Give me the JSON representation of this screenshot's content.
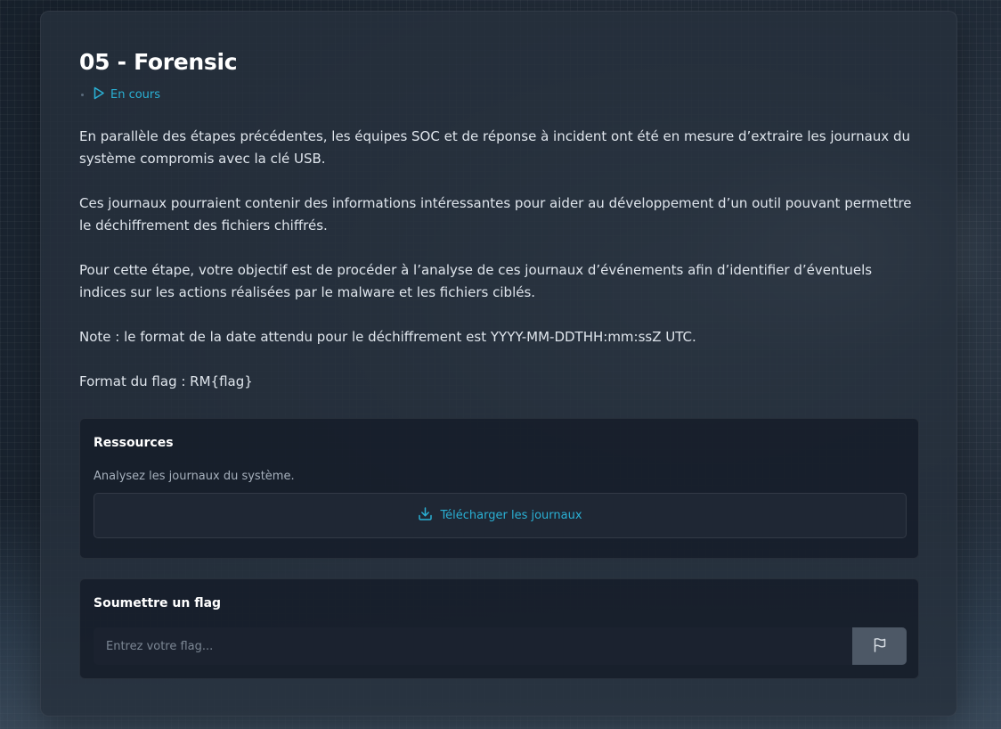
{
  "challenge": {
    "title": "05 - Forensic",
    "status": {
      "label": "En cours",
      "icon": "play-icon",
      "color": "#2ab0d4"
    },
    "description": [
      "En parallèle des étapes précédentes, les équipes SOC et de réponse à incident ont été en mesure d’extraire les journaux du système compromis avec la clé USB.",
      "Ces journaux pourraient contenir des informations intéressantes pour aider au développement d’un outil pouvant permettre le déchiffrement des fichiers chiffrés.",
      "Pour cette étape, votre objectif est de procéder à l’analyse de ces journaux d’événements afin d’identifier d’éventuels indices sur les actions réalisées par le malware et les fichiers ciblés.",
      "Note : le format de la date attendu pour le déchiffrement est YYYY-MM-DDTHH:mm:ssZ UTC.",
      "Format du flag : RM{flag}"
    ]
  },
  "resources": {
    "title": "Ressources",
    "description": "Analysez les journaux du système.",
    "download_label": "Télécharger les journaux",
    "download_icon": "download-icon"
  },
  "submit": {
    "title": "Soumettre un flag",
    "placeholder": "Entrez votre flag...",
    "button_icon": "flag-icon"
  },
  "colors": {
    "accent": "#2ab0d4",
    "card_bg": "#262f3c",
    "panel_bg": "#151c28",
    "submit_button": "#4d5866"
  }
}
